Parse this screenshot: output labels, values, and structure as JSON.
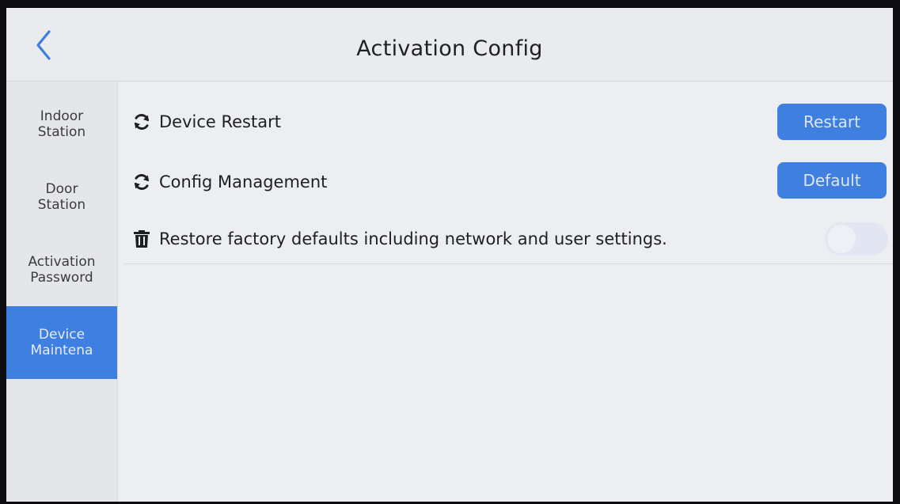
{
  "header": {
    "title": "Activation Config",
    "back_icon": "chevron-left-icon"
  },
  "sidebar": {
    "items": [
      {
        "label": "Indoor\nStation",
        "active": false
      },
      {
        "label": "Door\nStation",
        "active": false
      },
      {
        "label": "Activation\nPassword",
        "active": false
      },
      {
        "label": "Device\nMaintena",
        "active": true
      }
    ]
  },
  "settings": [
    {
      "icon": "refresh-icon",
      "label": "Device Restart",
      "action": "Restart"
    },
    {
      "icon": "refresh-icon",
      "label": "Config Management",
      "action": "Default"
    },
    {
      "icon": "trash-icon",
      "label": "Restore factory defaults including network and user settings.",
      "toggle_on": false
    }
  ],
  "colors": {
    "accent": "#3f7fe0",
    "background": "#eceef1",
    "text": "#1e1f22"
  }
}
